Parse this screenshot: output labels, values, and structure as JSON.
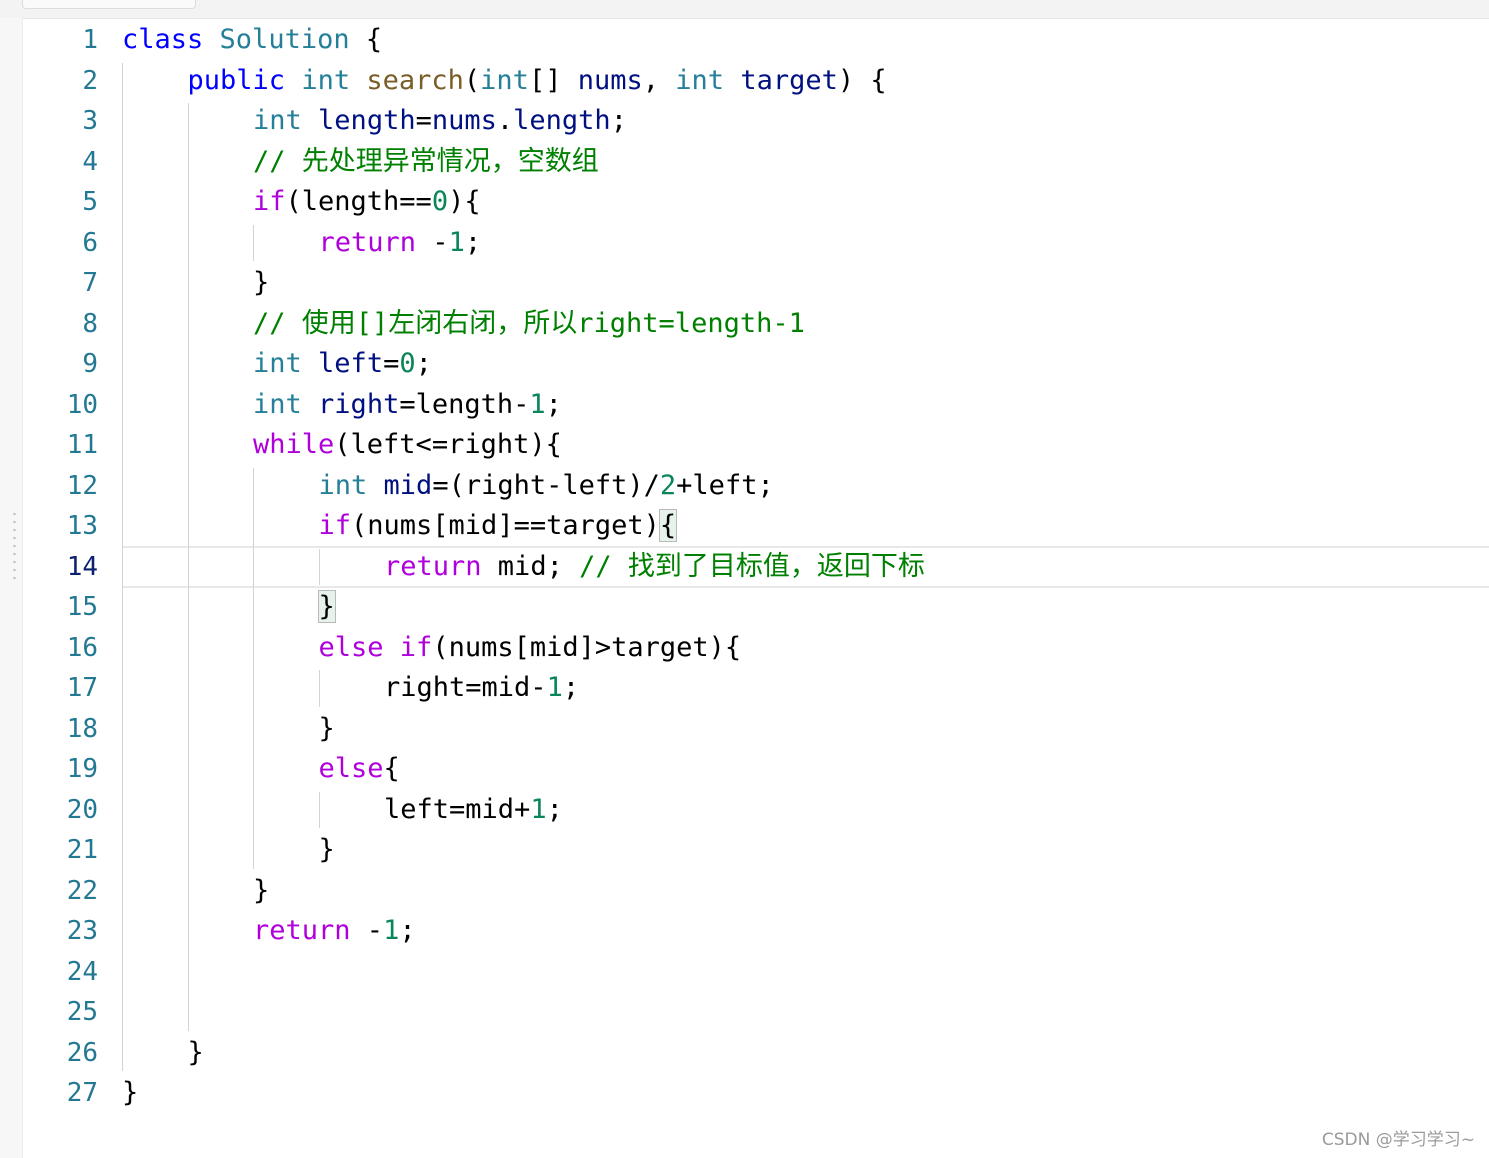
{
  "editor": {
    "active_line": 14,
    "lines": [
      {
        "n": "1",
        "indent": 0,
        "tokens": [
          {
            "t": "class",
            "c": "kw"
          },
          {
            "t": " "
          },
          {
            "t": "Solution",
            "c": "type"
          },
          {
            "t": " {"
          }
        ]
      },
      {
        "n": "2",
        "indent": 1,
        "tokens": [
          {
            "t": "public",
            "c": "kw"
          },
          {
            "t": " "
          },
          {
            "t": "int",
            "c": "type"
          },
          {
            "t": " "
          },
          {
            "t": "search",
            "c": "fn"
          },
          {
            "t": "("
          },
          {
            "t": "int",
            "c": "type"
          },
          {
            "t": "[] "
          },
          {
            "t": "nums",
            "c": "var"
          },
          {
            "t": ", "
          },
          {
            "t": "int",
            "c": "type"
          },
          {
            "t": " "
          },
          {
            "t": "target",
            "c": "var"
          },
          {
            "t": ") {"
          }
        ]
      },
      {
        "n": "3",
        "indent": 2,
        "tokens": [
          {
            "t": "int",
            "c": "type"
          },
          {
            "t": " "
          },
          {
            "t": "length",
            "c": "var"
          },
          {
            "t": "="
          },
          {
            "t": "nums",
            "c": "var"
          },
          {
            "t": "."
          },
          {
            "t": "length",
            "c": "var"
          },
          {
            "t": ";"
          }
        ]
      },
      {
        "n": "4",
        "indent": 2,
        "tokens": [
          {
            "t": "// 先处理异常情况，空数组",
            "c": "cmt"
          }
        ]
      },
      {
        "n": "5",
        "indent": 2,
        "tokens": [
          {
            "t": "if",
            "c": "ctl"
          },
          {
            "t": "(length=="
          },
          {
            "t": "0",
            "c": "num"
          },
          {
            "t": "){"
          }
        ]
      },
      {
        "n": "6",
        "indent": 3,
        "tokens": [
          {
            "t": "return",
            "c": "ctl"
          },
          {
            "t": " -"
          },
          {
            "t": "1",
            "c": "num"
          },
          {
            "t": ";"
          }
        ]
      },
      {
        "n": "7",
        "indent": 2,
        "tokens": [
          {
            "t": "}"
          }
        ]
      },
      {
        "n": "8",
        "indent": 2,
        "tokens": [
          {
            "t": "// 使用[]左闭右闭，所以right=length-1",
            "c": "cmt"
          }
        ]
      },
      {
        "n": "9",
        "indent": 2,
        "tokens": [
          {
            "t": "int",
            "c": "type"
          },
          {
            "t": " "
          },
          {
            "t": "left",
            "c": "var"
          },
          {
            "t": "="
          },
          {
            "t": "0",
            "c": "num"
          },
          {
            "t": ";"
          }
        ]
      },
      {
        "n": "10",
        "indent": 2,
        "tokens": [
          {
            "t": "int",
            "c": "type"
          },
          {
            "t": " "
          },
          {
            "t": "right",
            "c": "var"
          },
          {
            "t": "=length-"
          },
          {
            "t": "1",
            "c": "num"
          },
          {
            "t": ";"
          }
        ]
      },
      {
        "n": "11",
        "indent": 2,
        "tokens": [
          {
            "t": "while",
            "c": "ctl"
          },
          {
            "t": "(left<=right){"
          }
        ]
      },
      {
        "n": "12",
        "indent": 3,
        "tokens": [
          {
            "t": "int",
            "c": "type"
          },
          {
            "t": " "
          },
          {
            "t": "mid",
            "c": "var"
          },
          {
            "t": "=(right-left)/"
          },
          {
            "t": "2",
            "c": "num"
          },
          {
            "t": "+left;"
          }
        ]
      },
      {
        "n": "13",
        "indent": 3,
        "tokens": [
          {
            "t": "if",
            "c": "ctl"
          },
          {
            "t": "(nums[mid]==target)"
          },
          {
            "t": "{",
            "c": "brk"
          }
        ]
      },
      {
        "n": "14",
        "indent": 4,
        "tokens": [
          {
            "t": "return",
            "c": "ctl"
          },
          {
            "t": " mid; "
          },
          {
            "t": "// 找到了目标值，返回下标",
            "c": "cmt"
          }
        ]
      },
      {
        "n": "15",
        "indent": 3,
        "tokens": [
          {
            "t": "}",
            "c": "brk"
          }
        ]
      },
      {
        "n": "16",
        "indent": 3,
        "tokens": [
          {
            "t": "else",
            "c": "ctl"
          },
          {
            "t": " "
          },
          {
            "t": "if",
            "c": "ctl"
          },
          {
            "t": "(nums[mid]>target){"
          }
        ]
      },
      {
        "n": "17",
        "indent": 4,
        "tokens": [
          {
            "t": "right=mid-"
          },
          {
            "t": "1",
            "c": "num"
          },
          {
            "t": ";"
          }
        ]
      },
      {
        "n": "18",
        "indent": 3,
        "tokens": [
          {
            "t": "}"
          }
        ]
      },
      {
        "n": "19",
        "indent": 3,
        "tokens": [
          {
            "t": "else",
            "c": "ctl"
          },
          {
            "t": "{"
          }
        ]
      },
      {
        "n": "20",
        "indent": 4,
        "tokens": [
          {
            "t": "left=mid+"
          },
          {
            "t": "1",
            "c": "num"
          },
          {
            "t": ";"
          }
        ]
      },
      {
        "n": "21",
        "indent": 3,
        "tokens": [
          {
            "t": "}"
          }
        ]
      },
      {
        "n": "22",
        "indent": 2,
        "tokens": [
          {
            "t": "}"
          }
        ]
      },
      {
        "n": "23",
        "indent": 2,
        "tokens": [
          {
            "t": "return",
            "c": "ctl"
          },
          {
            "t": " -"
          },
          {
            "t": "1",
            "c": "num"
          },
          {
            "t": ";"
          }
        ]
      },
      {
        "n": "24",
        "indent": 0,
        "tokens": []
      },
      {
        "n": "25",
        "indent": 0,
        "tokens": []
      },
      {
        "n": "26",
        "indent": 1,
        "tokens": [
          {
            "t": "}"
          }
        ]
      },
      {
        "n": "27",
        "indent": 0,
        "tokens": [
          {
            "t": "}"
          }
        ]
      }
    ]
  },
  "watermark": "CSDN @学习学习~",
  "colors": {
    "keyword": "#0000ff",
    "control": "#af00db",
    "type": "#267f99",
    "function": "#795e26",
    "variable": "#001080",
    "number": "#098658",
    "comment": "#008000",
    "line_number": "#237893"
  }
}
